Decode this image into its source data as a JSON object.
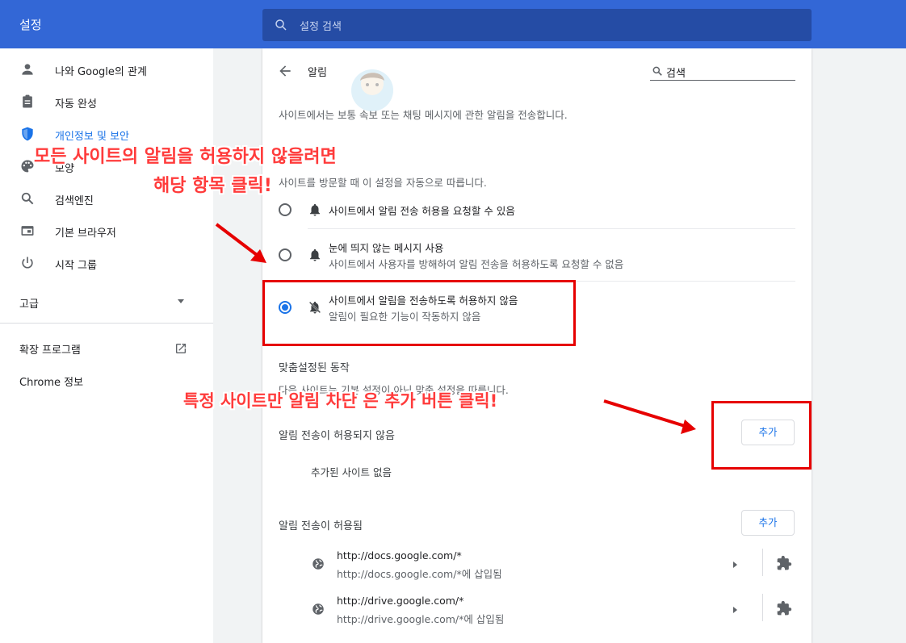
{
  "header": {
    "app_title": "설정",
    "search_placeholder": "설정 검색"
  },
  "sidebar": {
    "items": [
      {
        "label": "나와 Google의 관계",
        "icon": "person-icon"
      },
      {
        "label": "자동 완성",
        "icon": "clipboard-icon"
      },
      {
        "label": "개인정보 및 보안",
        "icon": "shield-icon",
        "active": true
      },
      {
        "label": "모양",
        "icon": "palette-icon"
      },
      {
        "label": "검색엔진",
        "icon": "search-icon"
      },
      {
        "label": "기본 브라우저",
        "icon": "browser-icon"
      },
      {
        "label": "시작 그룹",
        "icon": "power-icon"
      }
    ],
    "advanced_label": "고급",
    "extensions_label": "확장 프로그램",
    "about_label": "Chrome 정보"
  },
  "main": {
    "title": "알림",
    "search_value": "검색",
    "description": "사이트에서는 보통 속보 또는 채팅 메시지에 관한 알림을 전송합니다.",
    "default_behavior_desc": "사이트를 방문할 때 이 설정을 자동으로 따릅니다.",
    "options": [
      {
        "label": "사이트에서 알림 전송 허용을 요청할 수 있음",
        "sub": "",
        "selected": false
      },
      {
        "label": "눈에 띄지 않는 메시지 사용",
        "sub": "사이트에서 사용자를 방해하여 알림 전송을 허용하도록 요청할 수 없음",
        "selected": false
      },
      {
        "label": "사이트에서 알림을 전송하도록 허용하지 않음",
        "sub": "알림이 필요한 기능이 작동하지 않음",
        "selected": true
      }
    ],
    "custom_heading": "맞춤설정된 동작",
    "custom_desc": "다음 사이트는 기본 설정이 아닌 맞춤 설정을 따릅니다.",
    "blocked": {
      "heading": "알림 전송이 허용되지 않음",
      "add_label": "추가",
      "empty_msg": "추가된 사이트 없음"
    },
    "allowed": {
      "heading": "알림 전송이 허용됨",
      "add_label": "추가",
      "sites": [
        {
          "url": "http://docs.google.com/*",
          "sub": "http://docs.google.com/*에 삽입됨"
        },
        {
          "url": "http://drive.google.com/*",
          "sub": "http://drive.google.com/*에 삽입됨"
        }
      ]
    }
  },
  "annotations": {
    "callout1_line1": "모든 사이트의 알림을 허용하지 않을려면",
    "callout1_line2": "해당 항목 클릭!",
    "callout2": "특정 사이트만 알림 차단 은 추가 버튼 클릭!"
  },
  "colors": {
    "header_bg": "#3367d6",
    "accent": "#1a73e8",
    "annotation": "#e60000"
  }
}
